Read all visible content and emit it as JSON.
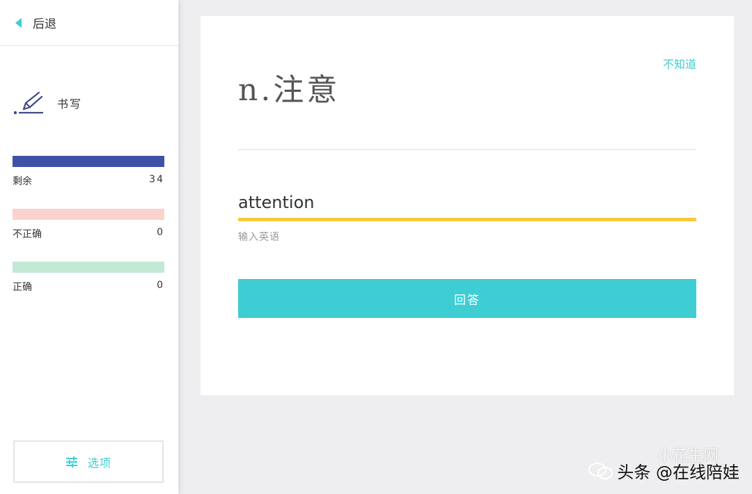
{
  "sidebar": {
    "back_label": "后退",
    "mode_label": "书写",
    "mode_icon": "pen-writing-icon",
    "stats": [
      {
        "label": "剩余",
        "value": "34",
        "color": "#3f51a6"
      },
      {
        "label": "不正确",
        "value": "0",
        "color": "#fbd3cc"
      },
      {
        "label": "正确",
        "value": "0",
        "color": "#c3e8d6"
      }
    ],
    "options_label": "选项",
    "options_icon": "sliders-icon"
  },
  "card": {
    "dont_know_label": "不知道",
    "prompt": "n.注意",
    "answer_value": "attention",
    "answer_hint": "输入英语",
    "submit_label": "回答"
  },
  "watermark": {
    "text": "头条 @在线陪娃",
    "faint_text": "小花生网"
  },
  "colors": {
    "accent": "#3ecdd3",
    "input_underline": "#f6c93f",
    "remaining_bar": "#3f51a6",
    "incorrect_bar": "#fbd3cc",
    "correct_bar": "#c3e8d6"
  }
}
